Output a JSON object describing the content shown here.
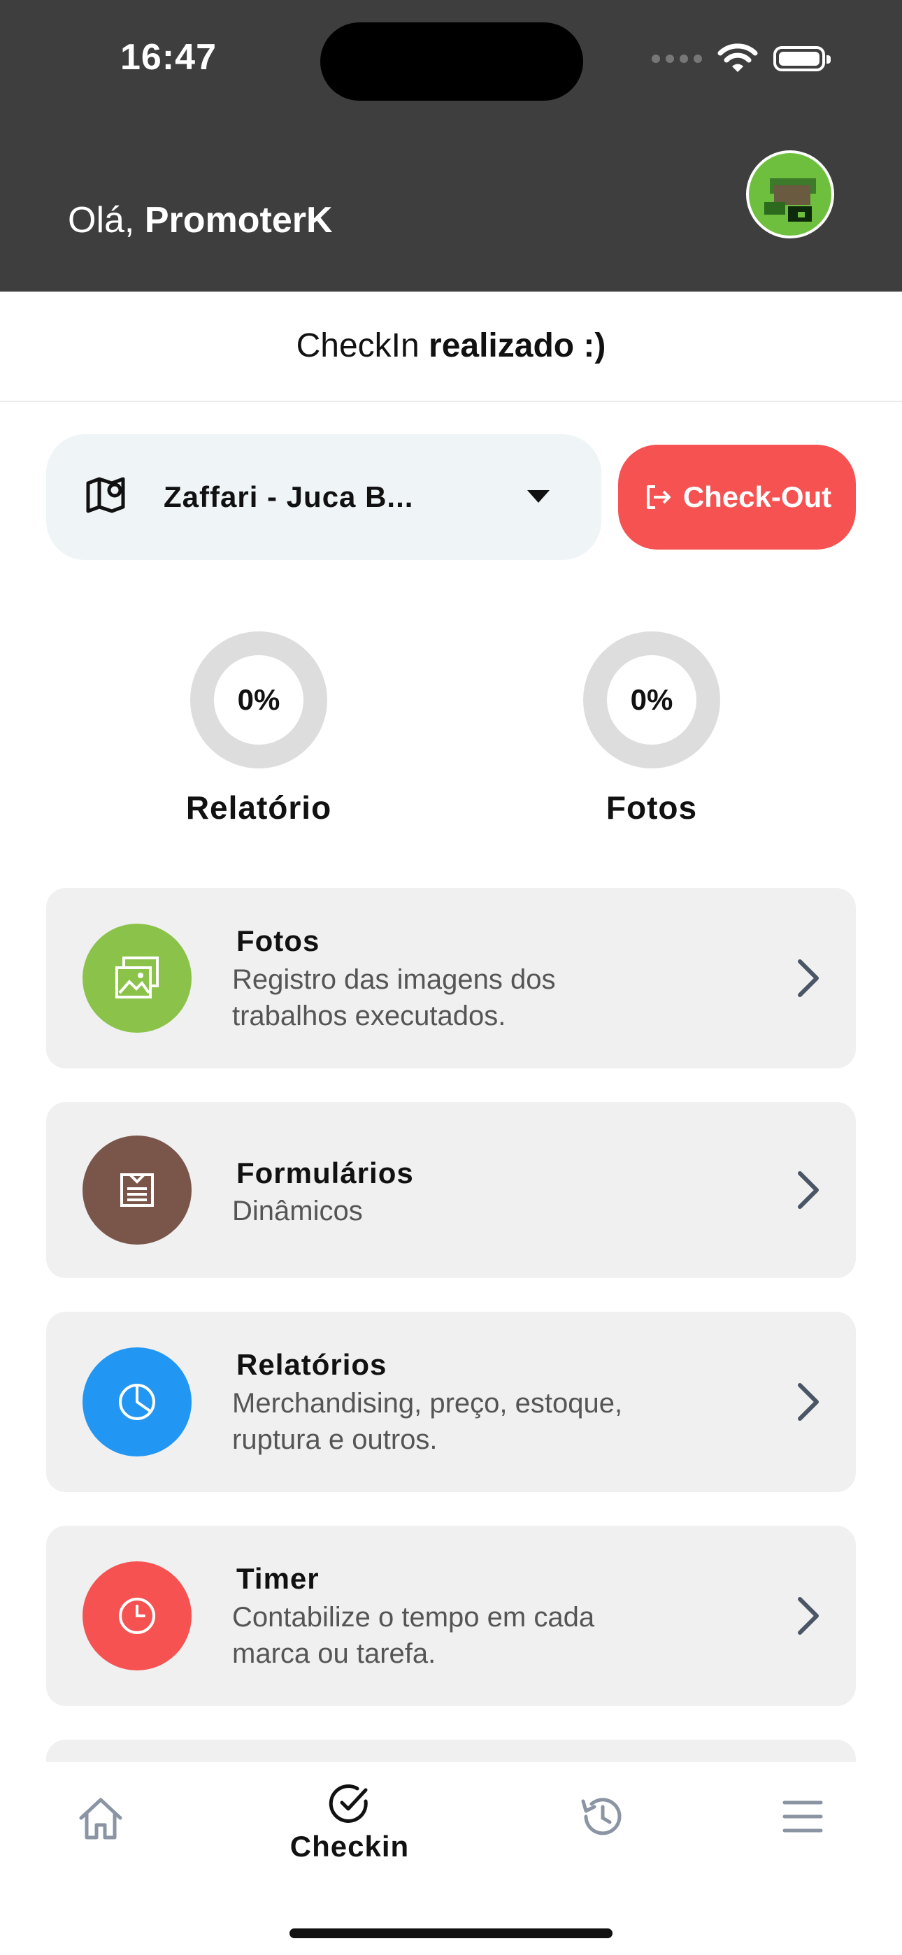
{
  "status_bar": {
    "time": "16:47"
  },
  "header": {
    "greeting_prefix": "Olá,",
    "user_name": "PromoterK"
  },
  "banner": {
    "prefix": "CheckIn",
    "status": "realizado :)"
  },
  "store": {
    "selected": "Zaffari - Juca B..."
  },
  "checkout": {
    "label": "Check-Out"
  },
  "progress": [
    {
      "value": "0%",
      "label": "Relatório"
    },
    {
      "value": "0%",
      "label": "Fotos"
    }
  ],
  "cards": [
    {
      "title": "Fotos",
      "desc_line1": "Registro das imagens dos",
      "desc_line2": "trabalhos executados.",
      "icon": "photos-icon",
      "color": "#8bc34a"
    },
    {
      "title": "Formulários",
      "desc_line1": "Dinâmicos",
      "desc_line2": "",
      "icon": "form-icon",
      "color": "#79554a"
    },
    {
      "title": "Relatórios",
      "desc_line1": "Merchandising, preço, estoque,",
      "desc_line2": "ruptura e outros.",
      "icon": "pie-chart-icon",
      "color": "#2196f3"
    },
    {
      "title": "Timer",
      "desc_line1": "Contabilize o tempo em cada",
      "desc_line2": "marca ou tarefa.",
      "icon": "clock-icon",
      "color": "#f65252"
    }
  ],
  "tabbar": {
    "items": [
      {
        "name": "home",
        "icon": "home-icon",
        "label": ""
      },
      {
        "name": "checkin",
        "icon": "check-circle-icon",
        "label": "Checkin",
        "active": true
      },
      {
        "name": "history",
        "icon": "history-icon",
        "label": ""
      },
      {
        "name": "menu",
        "icon": "menu-icon",
        "label": ""
      }
    ]
  },
  "colors": {
    "header_bg": "#3f3e3e",
    "accent_red": "#f65252",
    "card_bg": "#f0f0f0"
  }
}
